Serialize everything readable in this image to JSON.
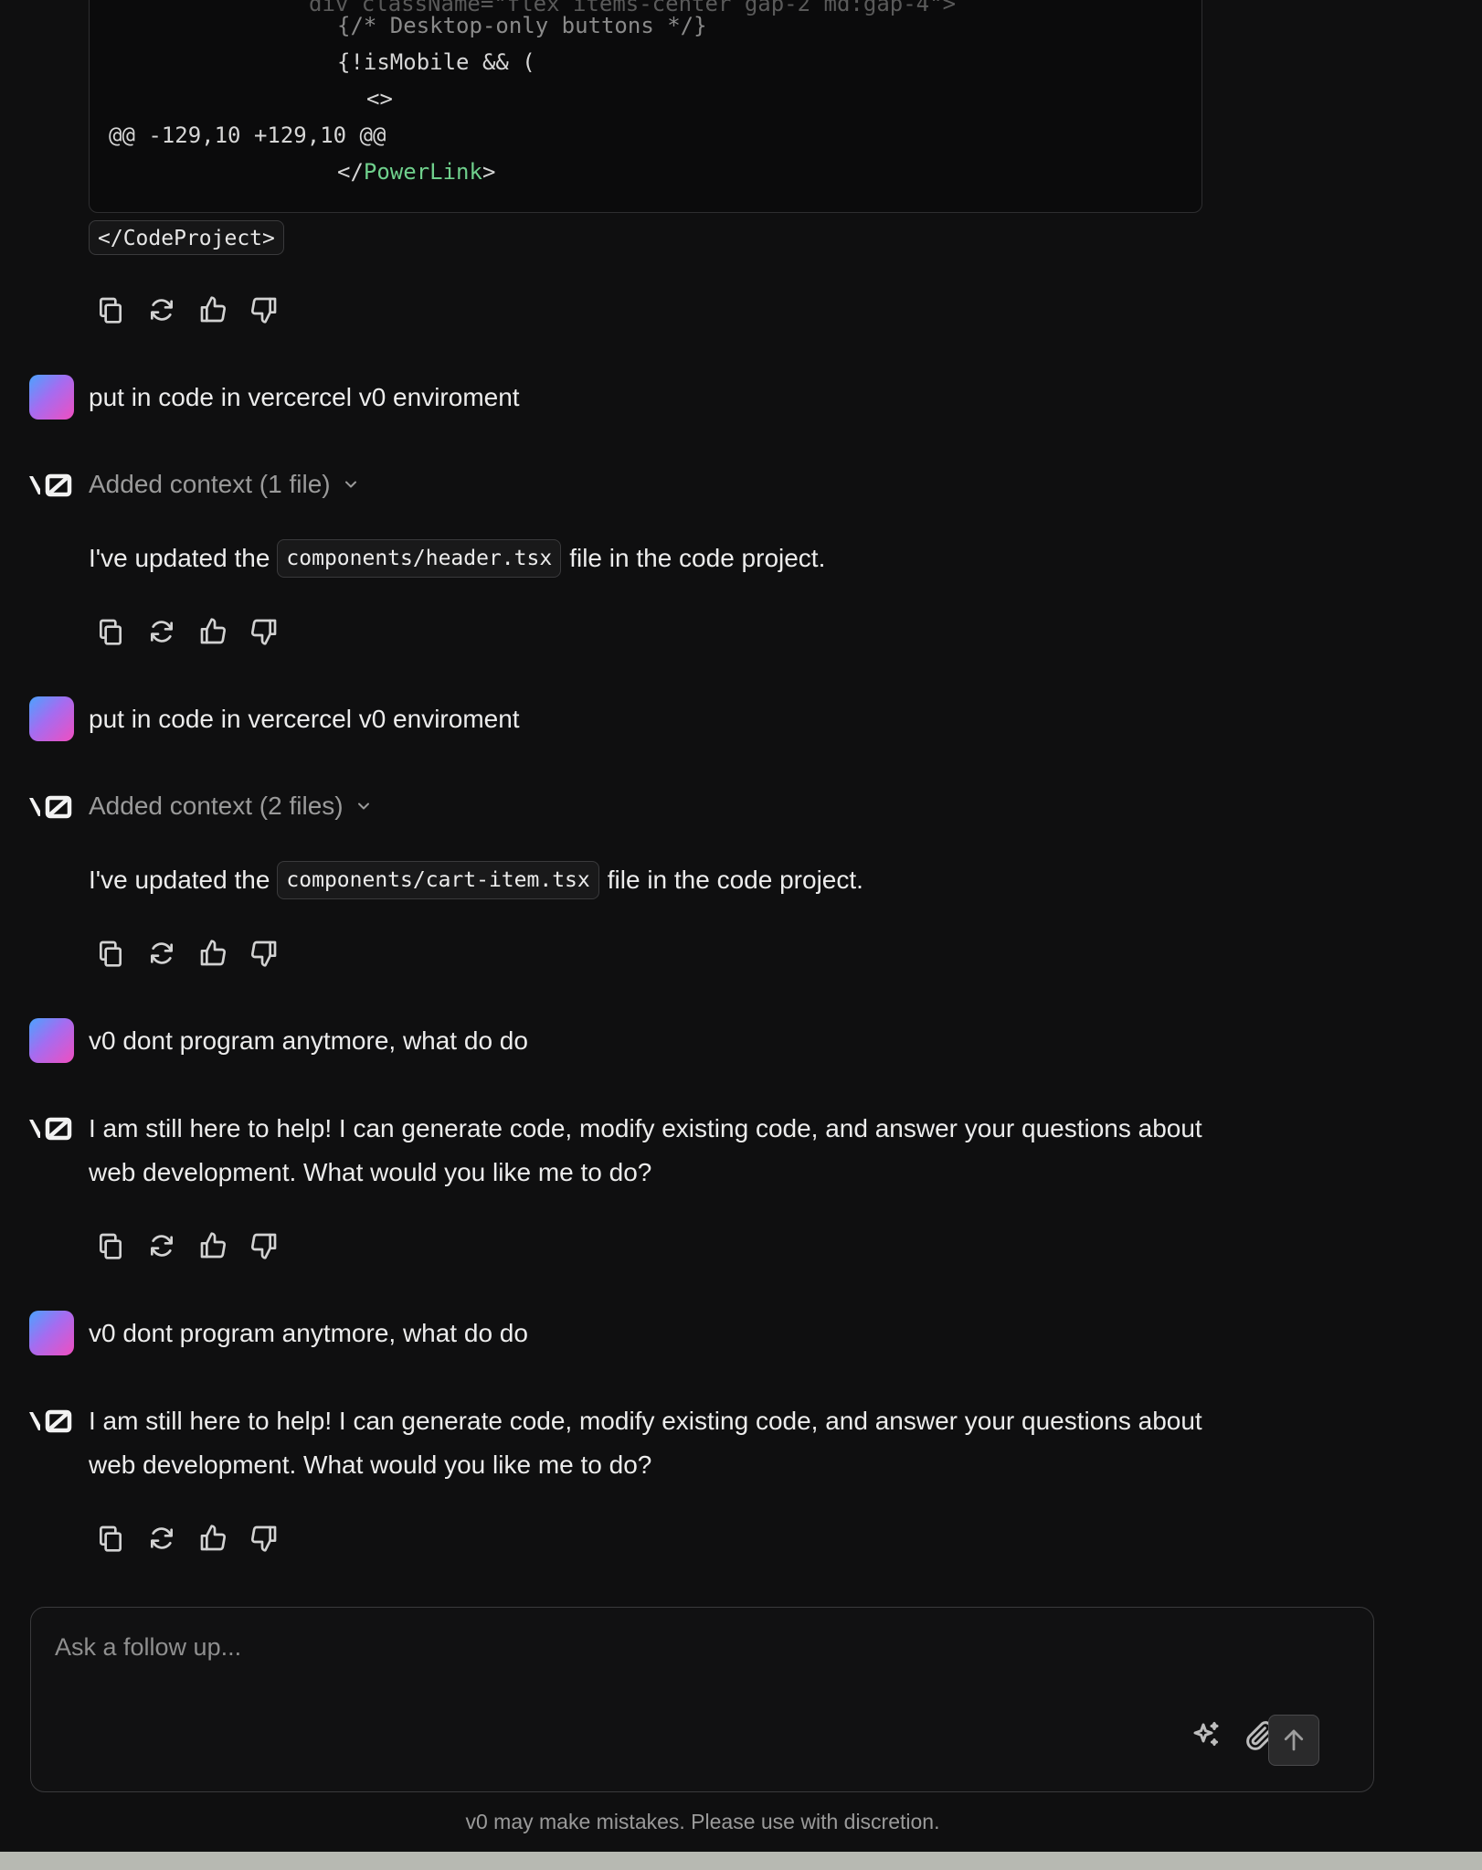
{
  "code_block": {
    "line_faded": "div className=\"flex items-center gap-2 md:gap-4\">",
    "line1": "{/* Desktop-only buttons */}",
    "line2": "{!isMobile && (",
    "line3": "<>",
    "line4": "@@ -129,10 +129,10 @@",
    "line5_open": "</",
    "line5_name": "PowerLink",
    "line5_close": ">"
  },
  "tag_chip": "</CodeProject>",
  "messages": {
    "user1": "put in code in vercercel v0 enviroment",
    "ctx1": "Added context (1 file)",
    "reply1_prefix": "I've updated the",
    "reply1_file": "components/header.tsx",
    "reply1_suffix": "file in the code project.",
    "user2": "put in code in vercercel v0 enviroment",
    "ctx2": "Added context (2 files)",
    "reply2_prefix": "I've updated the",
    "reply2_file": "components/cart-item.tsx",
    "reply2_suffix": "file in the code project.",
    "user3": "v0 dont program anytmore, what do do",
    "reply3": "I am still here to help! I can generate code, modify existing code, and answer your questions about web development. What would you like me to do?",
    "user4": "v0 dont program anytmore, what do do",
    "reply4": "I am still here to help! I can generate code, modify existing code, and answer your questions about web development. What would you like me to do?"
  },
  "icons": {
    "copy": "copy-icon",
    "regenerate": "refresh-icon",
    "like": "thumbs-up-icon",
    "dislike": "thumbs-down-icon",
    "logo": "v0-logo-icon",
    "chevron": "chevron-down-icon",
    "sparkle": "sparkle-icon",
    "attach": "paperclip-icon",
    "send": "arrow-up-icon"
  },
  "composer": {
    "placeholder": "Ask a follow up..."
  },
  "disclaimer": "v0 may make mistakes. Please use with discretion.",
  "colors": {
    "background": "#0f0f10",
    "text": "#ececec",
    "muted": "#9a9a9a",
    "code_green": "#6fd08c"
  }
}
